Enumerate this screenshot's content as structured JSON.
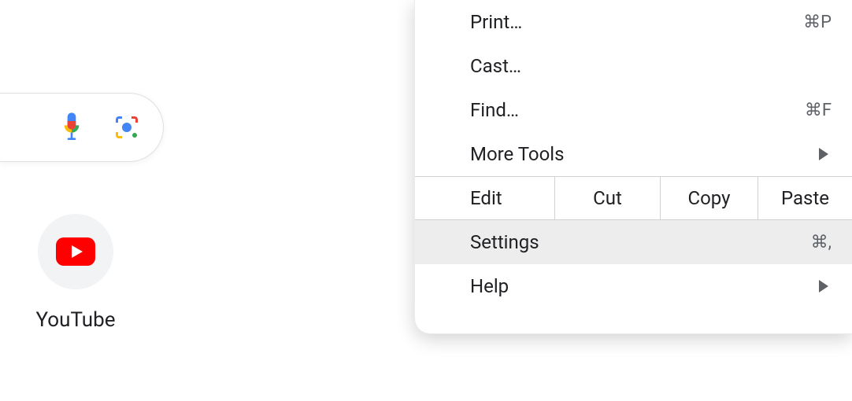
{
  "search": {
    "mic_icon": "microphone-icon",
    "lens_icon": "google-lens-icon"
  },
  "shortcut": {
    "label": "YouTube",
    "icon": "youtube-icon"
  },
  "menu": {
    "items": [
      {
        "label": "Print…",
        "shortcut": "⌘P"
      },
      {
        "label": "Cast…",
        "shortcut": ""
      },
      {
        "label": "Find…",
        "shortcut": "⌘F"
      },
      {
        "label": "More Tools",
        "shortcut": "",
        "submenu": true
      }
    ],
    "edit_row": {
      "label": "Edit",
      "actions": [
        "Cut",
        "Copy",
        "Paste"
      ]
    },
    "after": [
      {
        "label": "Settings",
        "shortcut": "⌘,",
        "selected": true
      },
      {
        "label": "Help",
        "shortcut": "",
        "submenu": true
      }
    ]
  }
}
